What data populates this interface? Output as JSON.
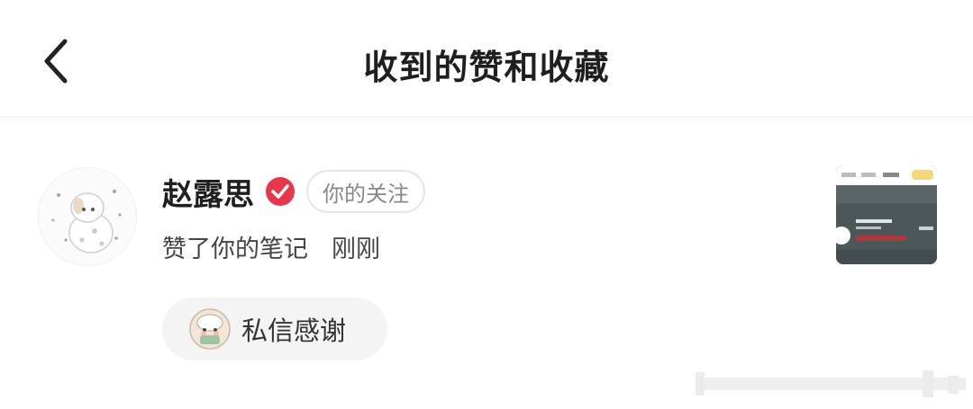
{
  "header": {
    "title": "收到的赞和收藏",
    "back_icon": "chevron-left-icon"
  },
  "notification": {
    "user_name": "赵露思",
    "verified_icon": "verified-check-icon",
    "verified_color": "#e8364a",
    "follow_tag": "你的关注",
    "action": "赞了你的笔记",
    "time": "刚刚",
    "thank_button": {
      "label": "私信感谢",
      "icon": "sticker-emoji-icon"
    }
  },
  "colors": {
    "background": "#ffffff",
    "divider": "#ececec",
    "pill_bg": "#f4f4f4",
    "accent_red": "#e8364a"
  }
}
